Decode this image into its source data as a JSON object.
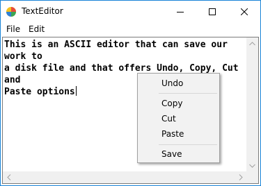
{
  "window": {
    "title": "TextEditor",
    "accent_color": "#1883d7"
  },
  "titlebar": {
    "app_icon": "app-icon",
    "minimize_icon": "minimize-icon",
    "maximize_icon": "maximize-icon",
    "close_icon": "close-icon"
  },
  "menubar": {
    "items": [
      {
        "label": "File"
      },
      {
        "label": "Edit"
      }
    ]
  },
  "editor": {
    "text": "This is an ASCII editor that can save our work to\na disk file and that offers Undo, Copy, Cut and\nPaste options"
  },
  "context_menu": {
    "items": [
      {
        "label": "Undo"
      },
      {
        "label": "Copy"
      },
      {
        "label": "Cut"
      },
      {
        "label": "Paste"
      },
      {
        "label": "Save"
      }
    ]
  }
}
